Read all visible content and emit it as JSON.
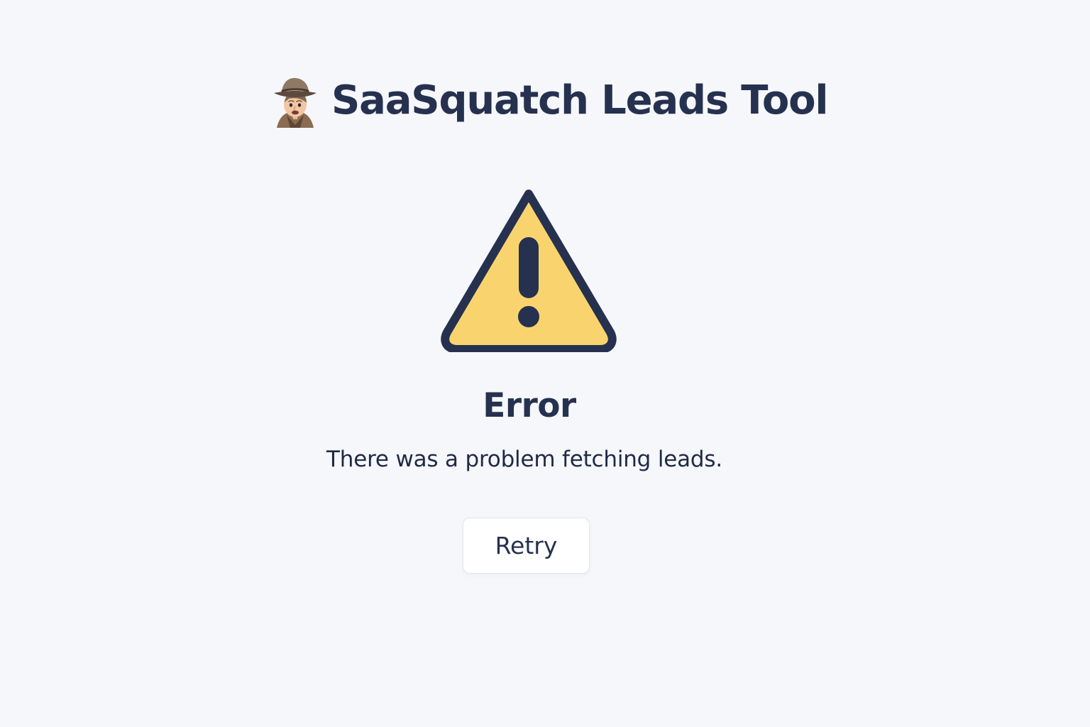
{
  "header": {
    "title": "SaaSquatch Leads Tool",
    "avatar_icon": "detective-icon"
  },
  "error_state": {
    "icon": "warning-icon",
    "title": "Error",
    "message": "There was a problem fetching leads.",
    "retry_label": "Retry"
  },
  "colors": {
    "background": "#f6f7fb",
    "text": "#26314f",
    "warning_fill": "#f9d46e",
    "warning_stroke": "#26314f",
    "button_bg": "#ffffff",
    "button_border": "#e2e5ec"
  }
}
